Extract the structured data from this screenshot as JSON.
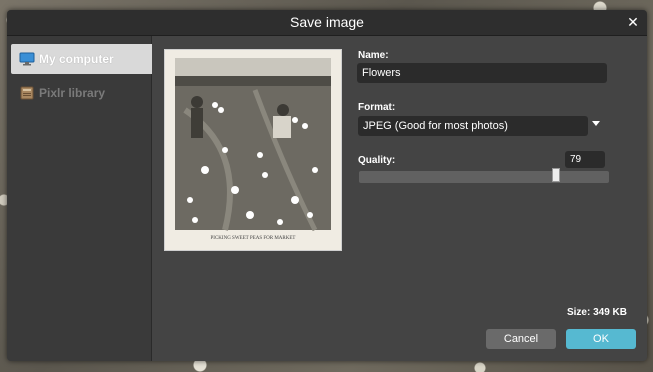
{
  "dialog": {
    "title": "Save image",
    "close_icon": "close-icon"
  },
  "sidebar": {
    "items": [
      {
        "label": "My computer",
        "icon": "monitor-icon",
        "active": true
      },
      {
        "label": "Pixlr library",
        "icon": "library-icon",
        "active": false
      }
    ]
  },
  "preview": {
    "caption": "PICKING SWEET PEAS FOR MARKET"
  },
  "form": {
    "name_label": "Name:",
    "name_value": "Flowers",
    "format_label": "Format:",
    "format_value": "JPEG (Good for most photos)",
    "quality_label": "Quality:",
    "quality_value": "79",
    "quality_fraction": 0.79,
    "size_text": "Size: 349 KB"
  },
  "buttons": {
    "cancel": "Cancel",
    "ok": "OK"
  },
  "colors": {
    "ok_button": "#56b9d1",
    "cancel_button": "#6a6a6a",
    "dialog_bg": "#444444"
  }
}
